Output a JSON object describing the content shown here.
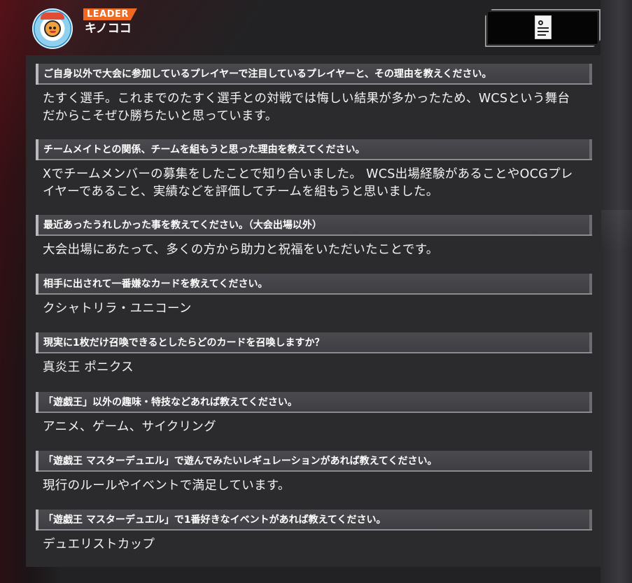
{
  "header": {
    "badge": "LEADER",
    "player_name": "キノココ",
    "avatar_icon": "player-avatar-icon",
    "deck_icon": "deck-list-icon"
  },
  "qa": [
    {
      "question": "ご自身以外で大会に参加しているプレイヤーで注目しているプレイヤーと、その理由を教えください。",
      "answer_lines": [
        "たすく選手。これまでのたすく選手との対戦では悔しい結果が多かったため、WCSという舞台",
        "だからこそぜひ勝ちたいと思っています。"
      ]
    },
    {
      "question": "チームメイトとの関係、チームを組もうと思った理由を教えてください。",
      "answer_lines": [
        "Xでチームメンバーの募集をしたことで知り合いました。 WCS出場経験があることやOCGプレ",
        "イヤーであること、実績などを評価してチームを組もうと思いました。"
      ]
    },
    {
      "question": "最近あったうれしかった事を教えてください。（大会出場以外）",
      "answer_lines": [
        "大会出場にあたって、多くの方から助力と祝福をいただいたことです。"
      ]
    },
    {
      "question": "相手に出されて一番嫌なカードを教えてください。",
      "answer_lines": [
        "クシャトリラ・ユニコーン"
      ]
    },
    {
      "question": "現実に1枚だけ召喚できるとしたらどのカードを召喚しますか？",
      "answer_lines": [
        "真炎王 ポニクス"
      ]
    },
    {
      "question": "「遊戯王」以外の趣味・特技などあれば教えてください。",
      "answer_lines": [
        "アニメ、ゲーム、サイクリング"
      ]
    },
    {
      "question": "「遊戯王 マスターデュエル」で遊んでみたいレギュレーションがあれば教えてください。",
      "answer_lines": [
        "現行のルールやイベントで満足しています。"
      ]
    },
    {
      "question": "「遊戯王 マスターデュエル」で1番好きなイベントがあれば教えてください。",
      "answer_lines": [
        "デュエリストカップ"
      ]
    }
  ]
}
